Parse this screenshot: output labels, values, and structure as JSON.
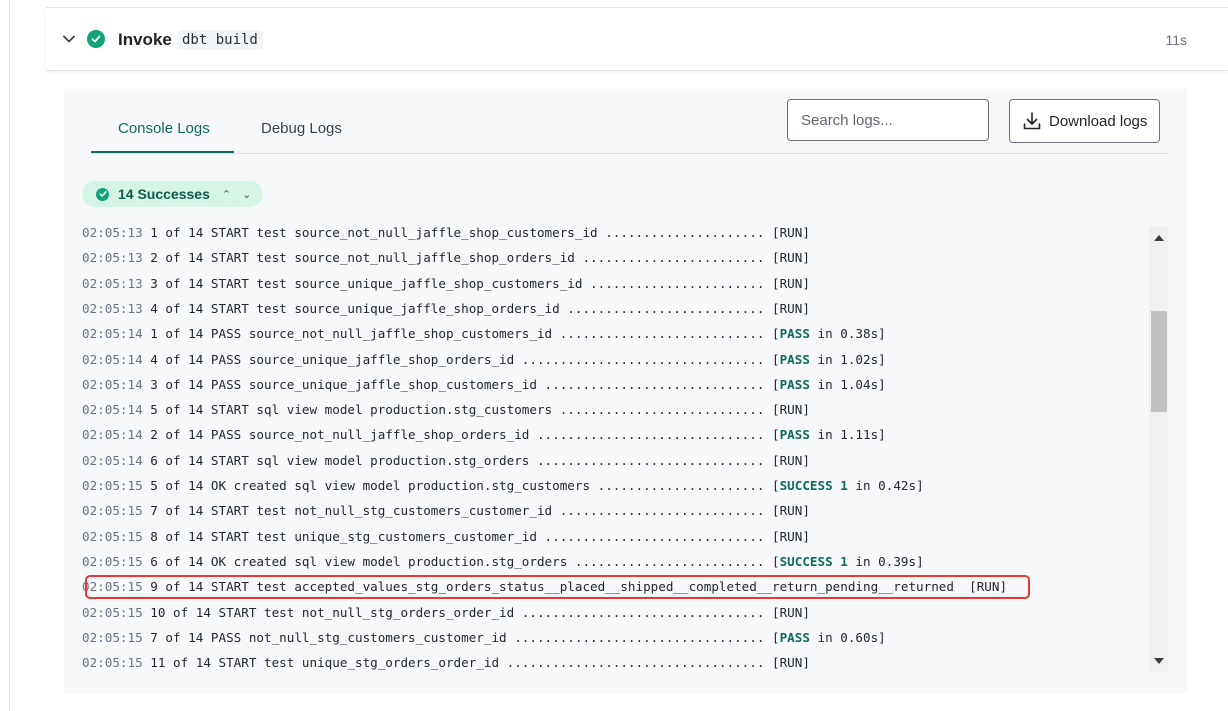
{
  "step": {
    "title": "Invoke",
    "command": "dbt build",
    "duration": "11s"
  },
  "tabs": {
    "console": "Console Logs",
    "debug": "Debug Logs"
  },
  "search": {
    "placeholder": "Search logs..."
  },
  "download": {
    "label": "Download logs"
  },
  "summary": {
    "label": "14 Successes"
  },
  "colors": {
    "accent": "#0f6a5c",
    "success": "#12a378",
    "highlight": "#e53935"
  },
  "logs": [
    {
      "ts": "02:05:13",
      "text": "1 of 14 START test source_not_null_jaffle_shop_customers_id ..................... [RUN]",
      "pre": "",
      "status": "",
      "post": ""
    },
    {
      "ts": "02:05:13",
      "text": "2 of 14 START test source_not_null_jaffle_shop_orders_id ........................ [RUN]",
      "pre": "",
      "status": "",
      "post": ""
    },
    {
      "ts": "02:05:13",
      "text": "3 of 14 START test source_unique_jaffle_shop_customers_id ....................... [RUN]",
      "pre": "",
      "status": "",
      "post": ""
    },
    {
      "ts": "02:05:13",
      "text": "4 of 14 START test source_unique_jaffle_shop_orders_id .......................... [RUN]",
      "pre": "",
      "status": "",
      "post": ""
    },
    {
      "ts": "02:05:14",
      "text": "1 of 14 PASS source_not_null_jaffle_shop_customers_id ........................... [",
      "pre": "",
      "status": "PASS",
      "post": " in 0.38s]"
    },
    {
      "ts": "02:05:14",
      "text": "4 of 14 PASS source_unique_jaffle_shop_orders_id ................................ [",
      "pre": "",
      "status": "PASS",
      "post": " in 1.02s]"
    },
    {
      "ts": "02:05:14",
      "text": "3 of 14 PASS source_unique_jaffle_shop_customers_id ............................. [",
      "pre": "",
      "status": "PASS",
      "post": " in 1.04s]"
    },
    {
      "ts": "02:05:14",
      "text": "5 of 14 START sql view model production.stg_customers ........................... [RUN]",
      "pre": "",
      "status": "",
      "post": ""
    },
    {
      "ts": "02:05:14",
      "text": "2 of 14 PASS source_not_null_jaffle_shop_orders_id .............................. [",
      "pre": "",
      "status": "PASS",
      "post": " in 1.11s]"
    },
    {
      "ts": "02:05:14",
      "text": "6 of 14 START sql view model production.stg_orders .............................. [RUN]",
      "pre": "",
      "status": "",
      "post": ""
    },
    {
      "ts": "02:05:15",
      "text": "5 of 14 OK created sql view model production.stg_customers ...................... [",
      "pre": "",
      "status": "SUCCESS 1",
      "post": " in 0.42s]"
    },
    {
      "ts": "02:05:15",
      "text": "7 of 14 START test not_null_stg_customers_customer_id ........................... [RUN]",
      "pre": "",
      "status": "",
      "post": ""
    },
    {
      "ts": "02:05:15",
      "text": "8 of 14 START test unique_stg_customers_customer_id ............................. [RUN]",
      "pre": "",
      "status": "",
      "post": ""
    },
    {
      "ts": "02:05:15",
      "text": "6 of 14 OK created sql view model production.stg_orders ......................... [",
      "pre": "",
      "status": "SUCCESS 1",
      "post": " in 0.39s]"
    },
    {
      "ts": "02:05:15",
      "text": "9 of 14 START test accepted_values_stg_orders_status__placed__shipped__completed__return_pending__returned  [RUN]",
      "pre": "",
      "status": "",
      "post": ""
    },
    {
      "ts": "02:05:15",
      "text": "10 of 14 START test not_null_stg_orders_order_id ................................ [RUN]",
      "pre": "",
      "status": "",
      "post": ""
    },
    {
      "ts": "02:05:15",
      "text": "7 of 14 PASS not_null_stg_customers_customer_id ................................. [",
      "pre": "",
      "status": "PASS",
      "post": " in 0.60s]"
    },
    {
      "ts": "02:05:15",
      "text": "11 of 14 START test unique_stg_orders_order_id .................................. [RUN]",
      "pre": "",
      "status": "",
      "post": ""
    }
  ]
}
